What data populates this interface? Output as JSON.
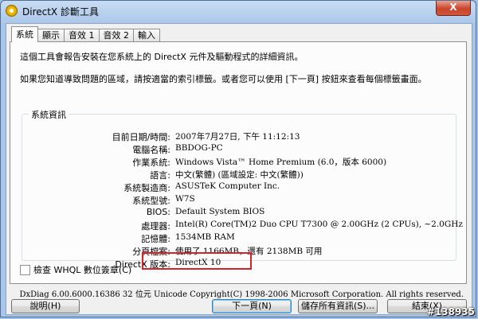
{
  "window": {
    "title": "DirectX 診斷工具",
    "close_label": "X"
  },
  "tabs": [
    {
      "label": "系統",
      "active": true
    },
    {
      "label": "顯示",
      "active": false
    },
    {
      "label": "音效 1",
      "active": false
    },
    {
      "label": "音效 2",
      "active": false
    },
    {
      "label": "輸入",
      "active": false
    }
  ],
  "intro": {
    "line1": "這個工具會報告安裝在您系統上的 DirectX 元件及驅動程式的詳細資訊。",
    "line2": "如果您知道導致問題的區域，請按適當的索引標籤。或者您可以使用 [下一頁] 按鈕來查看每個標籤畫面。"
  },
  "system_info": {
    "group_title": "系統資訊",
    "rows": [
      {
        "label": "目前日期/時間:",
        "value": "2007年7月27日, 下午 11:12:13"
      },
      {
        "label": "電腦名稱:",
        "value": "BBDOG-PC"
      },
      {
        "label": "作業系統:",
        "value": "Windows Vista™ Home Premium (6.0，版本 6000)"
      },
      {
        "label": "語言:",
        "value": "中文(繁體) (區域設定: 中文(繁體))"
      },
      {
        "label": "系統製造商:",
        "value": "ASUSTeK Computer Inc."
      },
      {
        "label": "系統型號:",
        "value": "W7S"
      },
      {
        "label": "BIOS:",
        "value": "Default System BIOS"
      },
      {
        "label": "處理器:",
        "value": "Intel(R) Core(TM)2 Duo CPU     T7300  @ 2.00GHz (2 CPUs), ~2.0GHz"
      },
      {
        "label": "記憶體:",
        "value": "1534MB RAM"
      },
      {
        "label": "分頁檔案:",
        "value": "使用了 1166MB，還有 2138MB 可用"
      },
      {
        "label": "DirectX 版本:",
        "value": "DirectX 10"
      }
    ]
  },
  "whql": {
    "label": "檢查 WHQL 數位簽章(C)",
    "checked": false
  },
  "footer": {
    "version_text": "DxDiag 6.00.6000.16386 32 位元 Unicode  Copyright(C) 1998-2006 Microsoft Corporation.  All rights reserved."
  },
  "buttons": {
    "help": "說明(H)",
    "next": "下一頁(N)",
    "save_all": "儲存所有資訊(S)...",
    "exit": "結束(X)"
  },
  "watermark": "#138935",
  "colors": {
    "highlight_border": "#d8222a",
    "titlebar": "#a9c6e8",
    "close_button": "#c8452b"
  }
}
